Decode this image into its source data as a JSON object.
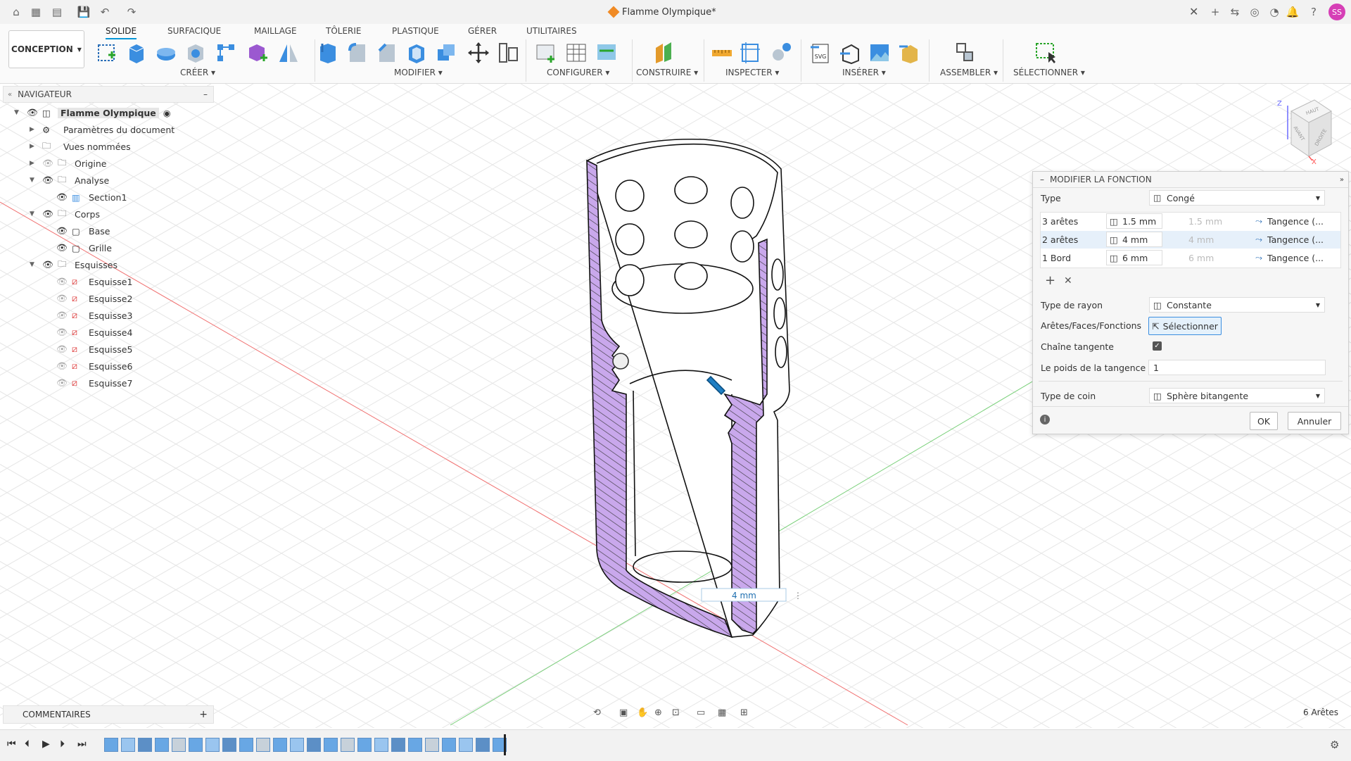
{
  "title_bar": {
    "document_title": "Flamme Olympique*",
    "avatar_initials": "SS"
  },
  "toolbar": {
    "workspace": "CONCEPTION",
    "tabs": [
      "SOLIDE",
      "SURFACIQUE",
      "MAILLAGE",
      "TÔLERIE",
      "PLASTIQUE",
      "GÉRER",
      "UTILITAIRES"
    ],
    "groups": [
      "CRÉER",
      "MODIFIER",
      "CONFIGURER",
      "CONSTRUIRE",
      "INSPECTER",
      "INSÉRER",
      "ASSEMBLER",
      "SÉLECTIONNER"
    ],
    "accent": "#0696d7"
  },
  "navigator": {
    "title": "NAVIGATEUR",
    "items": [
      {
        "label": "Flamme Olympique"
      },
      {
        "label": "Paramètres du document"
      },
      {
        "label": "Vues nommées"
      },
      {
        "label": "Origine"
      },
      {
        "label": "Analyse"
      },
      {
        "label": "Section1"
      },
      {
        "label": "Corps"
      },
      {
        "label": "Base"
      },
      {
        "label": "Grille"
      },
      {
        "label": "Esquisses"
      },
      {
        "label": "Esquisse1"
      },
      {
        "label": "Esquisse2"
      },
      {
        "label": "Esquisse3"
      },
      {
        "label": "Esquisse4"
      },
      {
        "label": "Esquisse5"
      },
      {
        "label": "Esquisse6"
      },
      {
        "label": "Esquisse7"
      }
    ]
  },
  "dialog": {
    "title": "MODIFIER LA FONCTION",
    "type_label": "Type",
    "type_value": "Congé",
    "rows": [
      {
        "name": "3 arêtes",
        "radius": "1.5 mm",
        "radius2": "1.5 mm",
        "continuity": "Tangence (..."
      },
      {
        "name": "2 arêtes",
        "radius": "4 mm",
        "radius2": "4 mm",
        "continuity": "Tangence (..."
      },
      {
        "name": "1 Bord",
        "radius": "6 mm",
        "radius2": "6 mm",
        "continuity": "Tangence (..."
      }
    ],
    "rayon_label": "Type de rayon",
    "rayon_value": "Constante",
    "select_label": "Arêtes/Faces/Fonctions",
    "select_button": "Sélectionner",
    "chain_label": "Chaîne tangente",
    "chain_checked": true,
    "weight_label": "Le poids de la tangence",
    "weight_value": "1",
    "corner_label": "Type de coin",
    "corner_value": "Sphère bitangente",
    "ok": "OK",
    "cancel": "Annuler"
  },
  "viewport": {
    "input_value": "4 mm",
    "selection_status": "6 Arêtes",
    "viewcube": {
      "top": "HAUT",
      "front": "AVANT",
      "right": "DROITE",
      "axis_z": "Z",
      "axis_x": "X"
    },
    "section_color": "#c9a8ec"
  },
  "comments": {
    "title": "COMMENTAIRES"
  }
}
